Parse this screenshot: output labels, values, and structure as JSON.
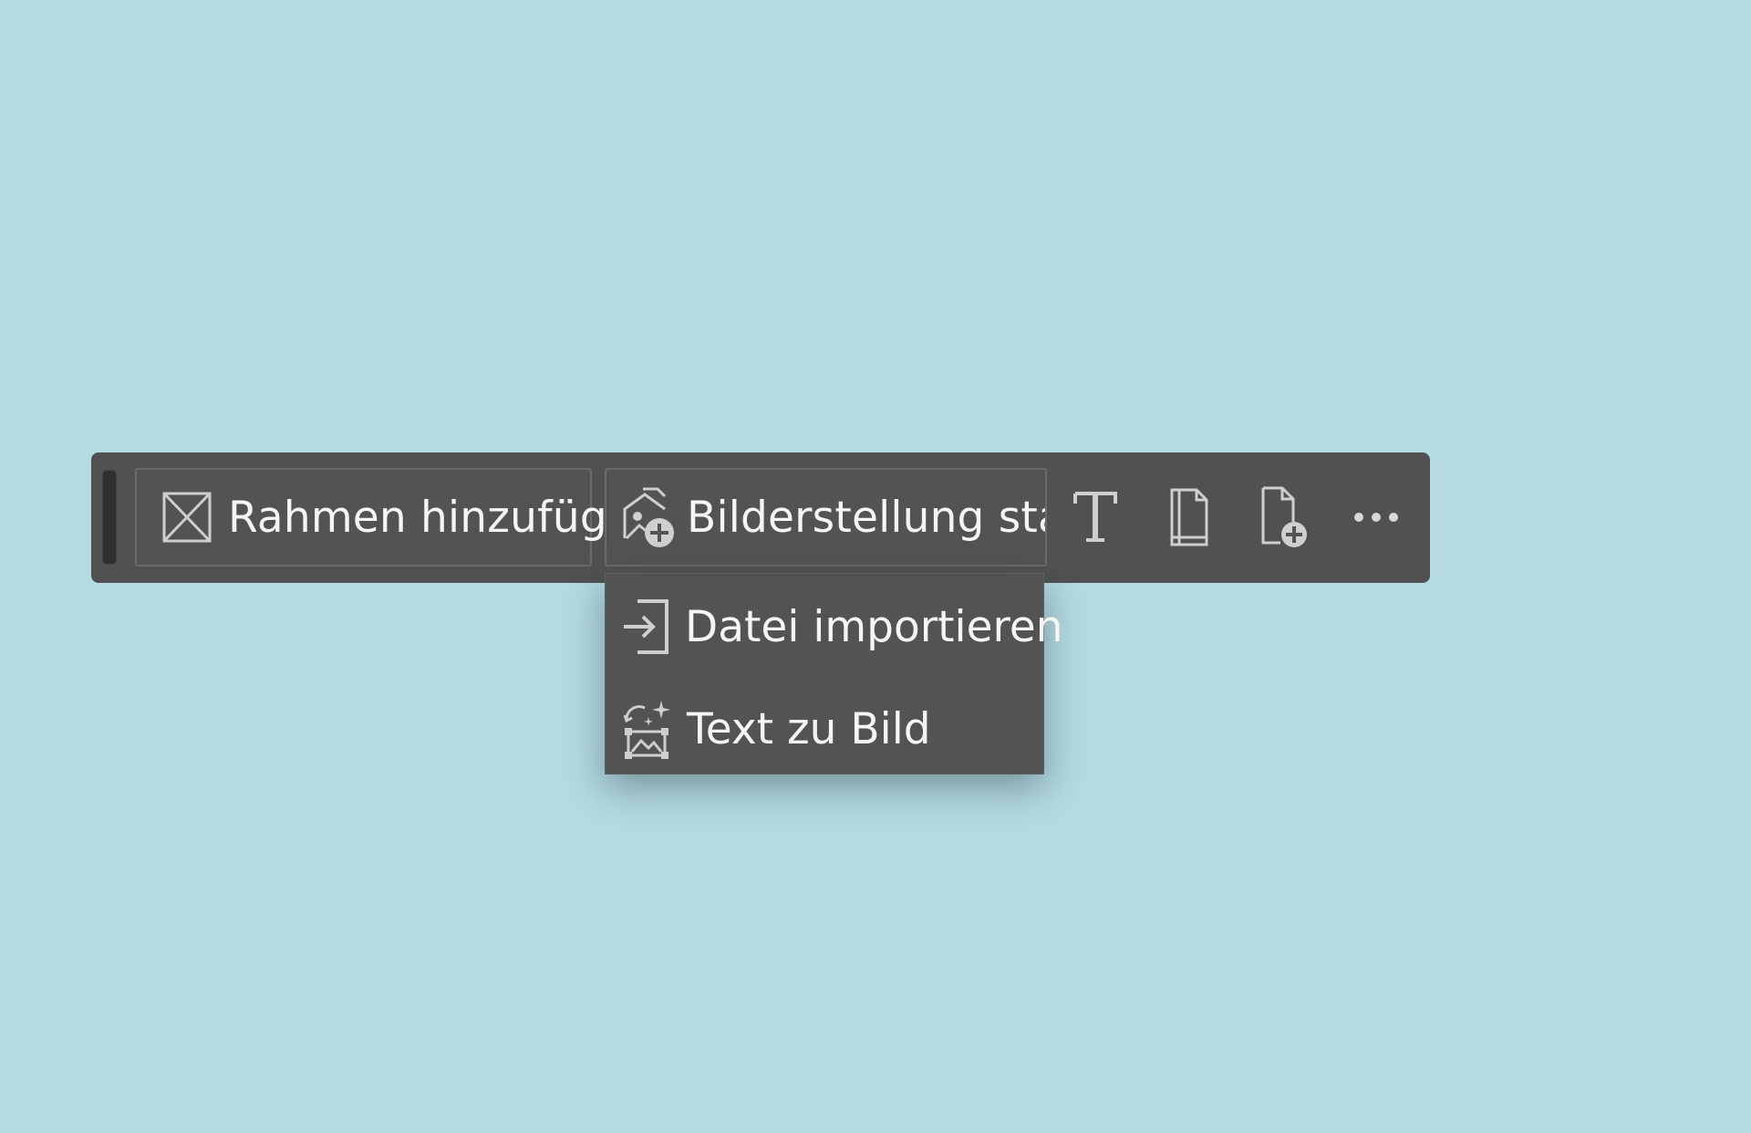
{
  "taskbar": {
    "frame_button": {
      "label": "Rahmen hinzufügen",
      "icon": "frame-placeholder-icon"
    },
    "generate_button": {
      "label": "Bilderstellung starten",
      "icon": "image-add-icon"
    },
    "icons": [
      {
        "name": "text-tool-icon"
      },
      {
        "name": "page-icon"
      },
      {
        "name": "add-page-icon"
      },
      {
        "name": "more-options-icon"
      }
    ]
  },
  "menu": {
    "items": [
      {
        "label": "Datei importieren",
        "icon": "import-file-icon"
      },
      {
        "label": "Text zu Bild",
        "icon": "text-to-image-icon"
      }
    ]
  },
  "colors": {
    "background": "#b5dae2",
    "bar": "#515151",
    "text": "#f5f5f5",
    "icon": "#cfcfcf"
  }
}
